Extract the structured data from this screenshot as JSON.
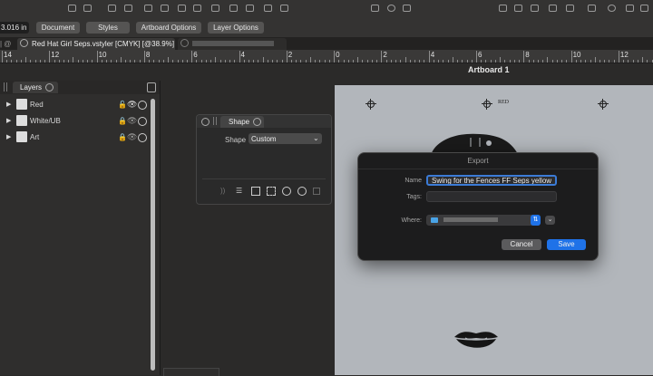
{
  "toolbar": {
    "position_value": "3.016 in",
    "buttons": [
      "Document",
      "Styles",
      "Artboard Options",
      "Layer Options"
    ]
  },
  "tabs": {
    "active": "Red Hat Girl Seps.vstyler [CMYK] [@38.9%]"
  },
  "ruler": {
    "labels": [
      "14",
      "12",
      "10",
      "8",
      "6",
      "4",
      "2",
      "0",
      "2",
      "4",
      "6",
      "8",
      "10",
      "12"
    ]
  },
  "artboard": {
    "title": "Artboard 1",
    "reg_label": "RED"
  },
  "layers": {
    "title": "Layers",
    "items": [
      {
        "name": "Red"
      },
      {
        "name": "White/UB"
      },
      {
        "name": "Art"
      }
    ]
  },
  "shape_panel": {
    "title": "Shape",
    "field_label": "Shape",
    "selected": "Custom"
  },
  "export": {
    "title": "Export",
    "name_label": "Name",
    "name_value": "Swing for the Fences FF Seps yellow",
    "tags_label": "Tags:",
    "where_label": "Where:",
    "cancel": "Cancel",
    "save": "Save"
  },
  "colors": {
    "accent": "#1f72e8",
    "artboard": "#b2b6bb"
  }
}
